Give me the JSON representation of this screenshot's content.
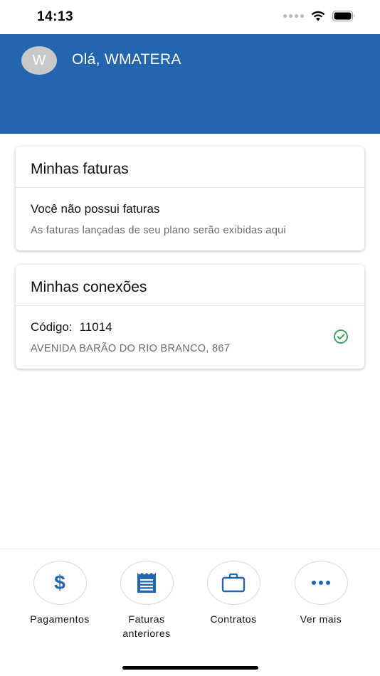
{
  "status_bar": {
    "time": "14:13"
  },
  "header": {
    "avatar_initial": "W",
    "greeting": "Olá, WMATERA"
  },
  "faturas": {
    "title": "Minhas faturas",
    "message": "Você não possui faturas",
    "description": "As faturas lançadas de seu plano serão exibidas aqui"
  },
  "conexoes": {
    "title": "Minhas conexões",
    "code_label": "Código:",
    "code_value": "11014",
    "address": "AVENIDA BARÃO DO RIO BRANCO, 867",
    "status_icon": "check-circle-icon"
  },
  "bottom_nav": {
    "items": [
      {
        "label": "Pagamentos",
        "icon": "dollar-icon",
        "glyph": "$"
      },
      {
        "label": "Faturas anteriores",
        "icon": "receipt-icon"
      },
      {
        "label": "Contratos",
        "icon": "briefcase-icon"
      },
      {
        "label": "Ver mais",
        "icon": "more-icon"
      }
    ]
  },
  "colors": {
    "brand": "#2465b0",
    "success": "#2e9e4f"
  }
}
